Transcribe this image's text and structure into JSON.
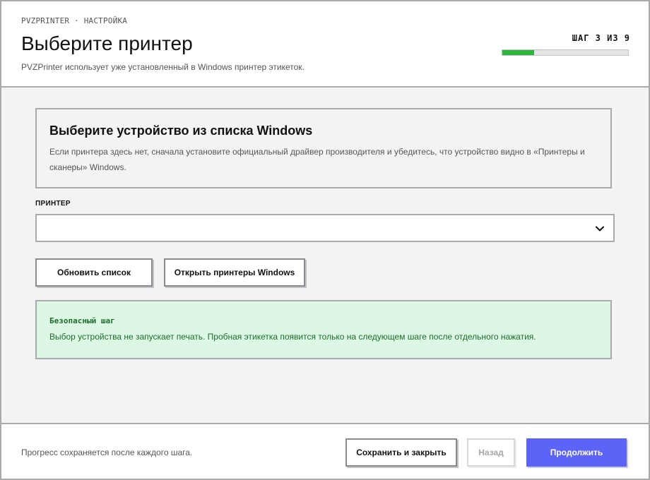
{
  "header": {
    "breadcrumb": "PVZPRINTER · НАСТРОЙКА",
    "title": "Выберите принтер",
    "subtitle": "PVZPrinter использует уже установленный в Windows принтер этикеток.",
    "step_label": "ШАГ 3 ИЗ 9",
    "progress_fraction": 0.25,
    "progress_color": "#2cb63a"
  },
  "card": {
    "title": "Выберите устройство из списка Windows",
    "description": "Если принтера здесь нет, сначала установите официальный драйвер производителя и убедитесь, что устройство видно в «Принтеры и сканеры» Windows."
  },
  "printer_select": {
    "label": "ПРИНТЕР",
    "value": "",
    "icon": "chevron-down-icon"
  },
  "actions": {
    "refresh_label": "Обновить список",
    "open_printers_label": "Открыть принтеры Windows"
  },
  "notice": {
    "title": "Безопасный шаг",
    "text": "Выбор устройства не запускает печать. Пробная этикетка появится только на следующем шаге после отдельного нажатия.",
    "background_color": "#dcf8e5",
    "text_color": "#1c6b2c"
  },
  "footer": {
    "info": "Прогресс сохраняется после каждого шага.",
    "save_close_label": "Сохранить и закрыть",
    "back_label": "Назад",
    "continue_label": "Продолжить",
    "accent_color": "#5d63f6"
  }
}
